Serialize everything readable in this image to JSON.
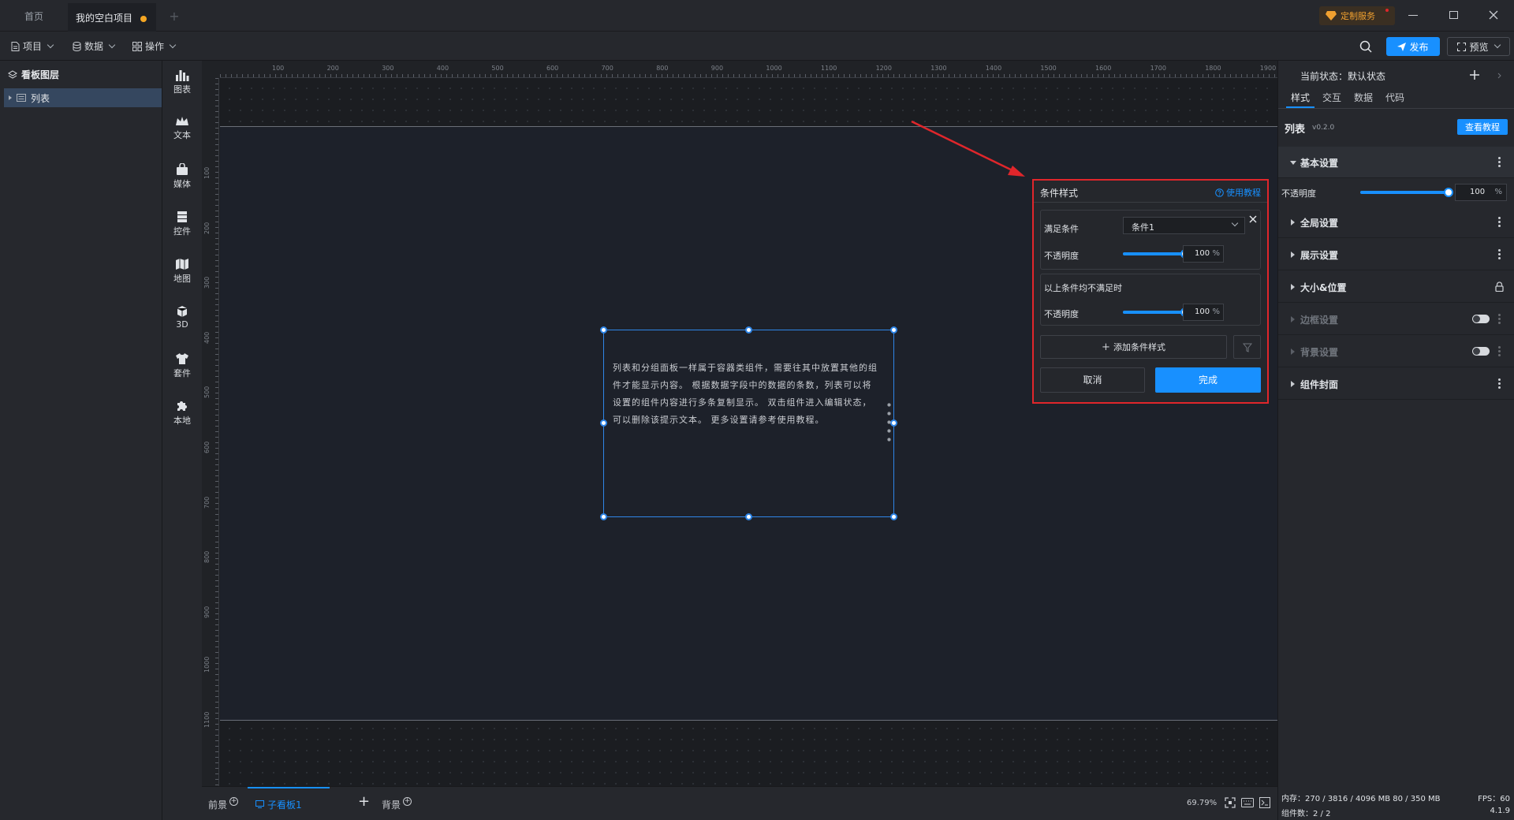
{
  "tabs": {
    "home": "首页",
    "project": "我的空白项目",
    "add": "+"
  },
  "window": {
    "custom_service": "定制服务"
  },
  "menus": {
    "project": "项目",
    "data": "数据",
    "operation": "操作"
  },
  "actions": {
    "publish": "发布",
    "preview": "预览"
  },
  "layers": {
    "title": "看板图层",
    "item": "列表"
  },
  "sidebar": [
    {
      "label": "图表",
      "icon": "bar-chart-icon"
    },
    {
      "label": "文本",
      "icon": "text-crown-icon"
    },
    {
      "label": "媒体",
      "icon": "media-bag-icon"
    },
    {
      "label": "控件",
      "icon": "control-stack-icon"
    },
    {
      "label": "地图",
      "icon": "map-icon"
    },
    {
      "label": "3D",
      "icon": "cube-icon"
    },
    {
      "label": "套件",
      "icon": "suit-icon"
    },
    {
      "label": "本地",
      "icon": "puzzle-icon"
    }
  ],
  "ruler": {
    "top": [
      "100",
      "200",
      "300",
      "400",
      "500",
      "600",
      "700",
      "800",
      "900",
      "1000",
      "1100",
      "1200",
      "1300",
      "1400",
      "1500",
      "1600",
      "1700",
      "1800",
      "1900"
    ],
    "left": [
      "100",
      "200",
      "300",
      "400",
      "500",
      "600",
      "700",
      "800",
      "900",
      "1000",
      "1100"
    ]
  },
  "widget": {
    "text": "列表和分组面板一样属于容器类组件，需要往其中放置其他的组件才能显示内容。 根据数据字段中的数据的条数，列表可以将设置的组件内容进行多条复制显示。 双击组件进入编辑状态，可以删除该提示文本。 更多设置请参考使用教程。"
  },
  "dialog": {
    "title": "条件样式",
    "help": "使用教程",
    "condition_label": "满足条件",
    "condition_value": "条件1",
    "opacity_label": "不透明度",
    "opacity_value": "100",
    "percent": "%",
    "else_label": "以上条件均不满足时",
    "else_opacity_label": "不透明度",
    "else_opacity_value": "100",
    "add": "添加条件样式",
    "cancel": "取消",
    "confirm": "完成",
    "opacity_level": 1.0
  },
  "props": {
    "state_label": "当前状态：默认状态",
    "tabs": [
      "样式",
      "交互",
      "数据",
      "代码"
    ],
    "component": "列表",
    "version": "v0.2.0",
    "tutorial": "查看教程",
    "basic": "基本设置",
    "opacity_label": "不透明度",
    "opacity_value": "100",
    "percent": "%",
    "opacity_level": 1.0,
    "sections": [
      "全局设置",
      "展示设置",
      "大小&位置",
      "边框设置",
      "背景设置",
      "组件封面"
    ]
  },
  "bottom": {
    "front": "前景",
    "board": "子看板1",
    "add": "+",
    "back": "背景",
    "zoom": "69.79%",
    "memory": "内存：270 / 3816 / 4096 MB  80 / 350 MB",
    "fps": "FPS：60",
    "count": "组件数：2 / 2",
    "version": "4.1.9"
  },
  "colors": {
    "accent": "#1890ff",
    "highlight": "#e0262b",
    "selection": "#2f86e8"
  }
}
